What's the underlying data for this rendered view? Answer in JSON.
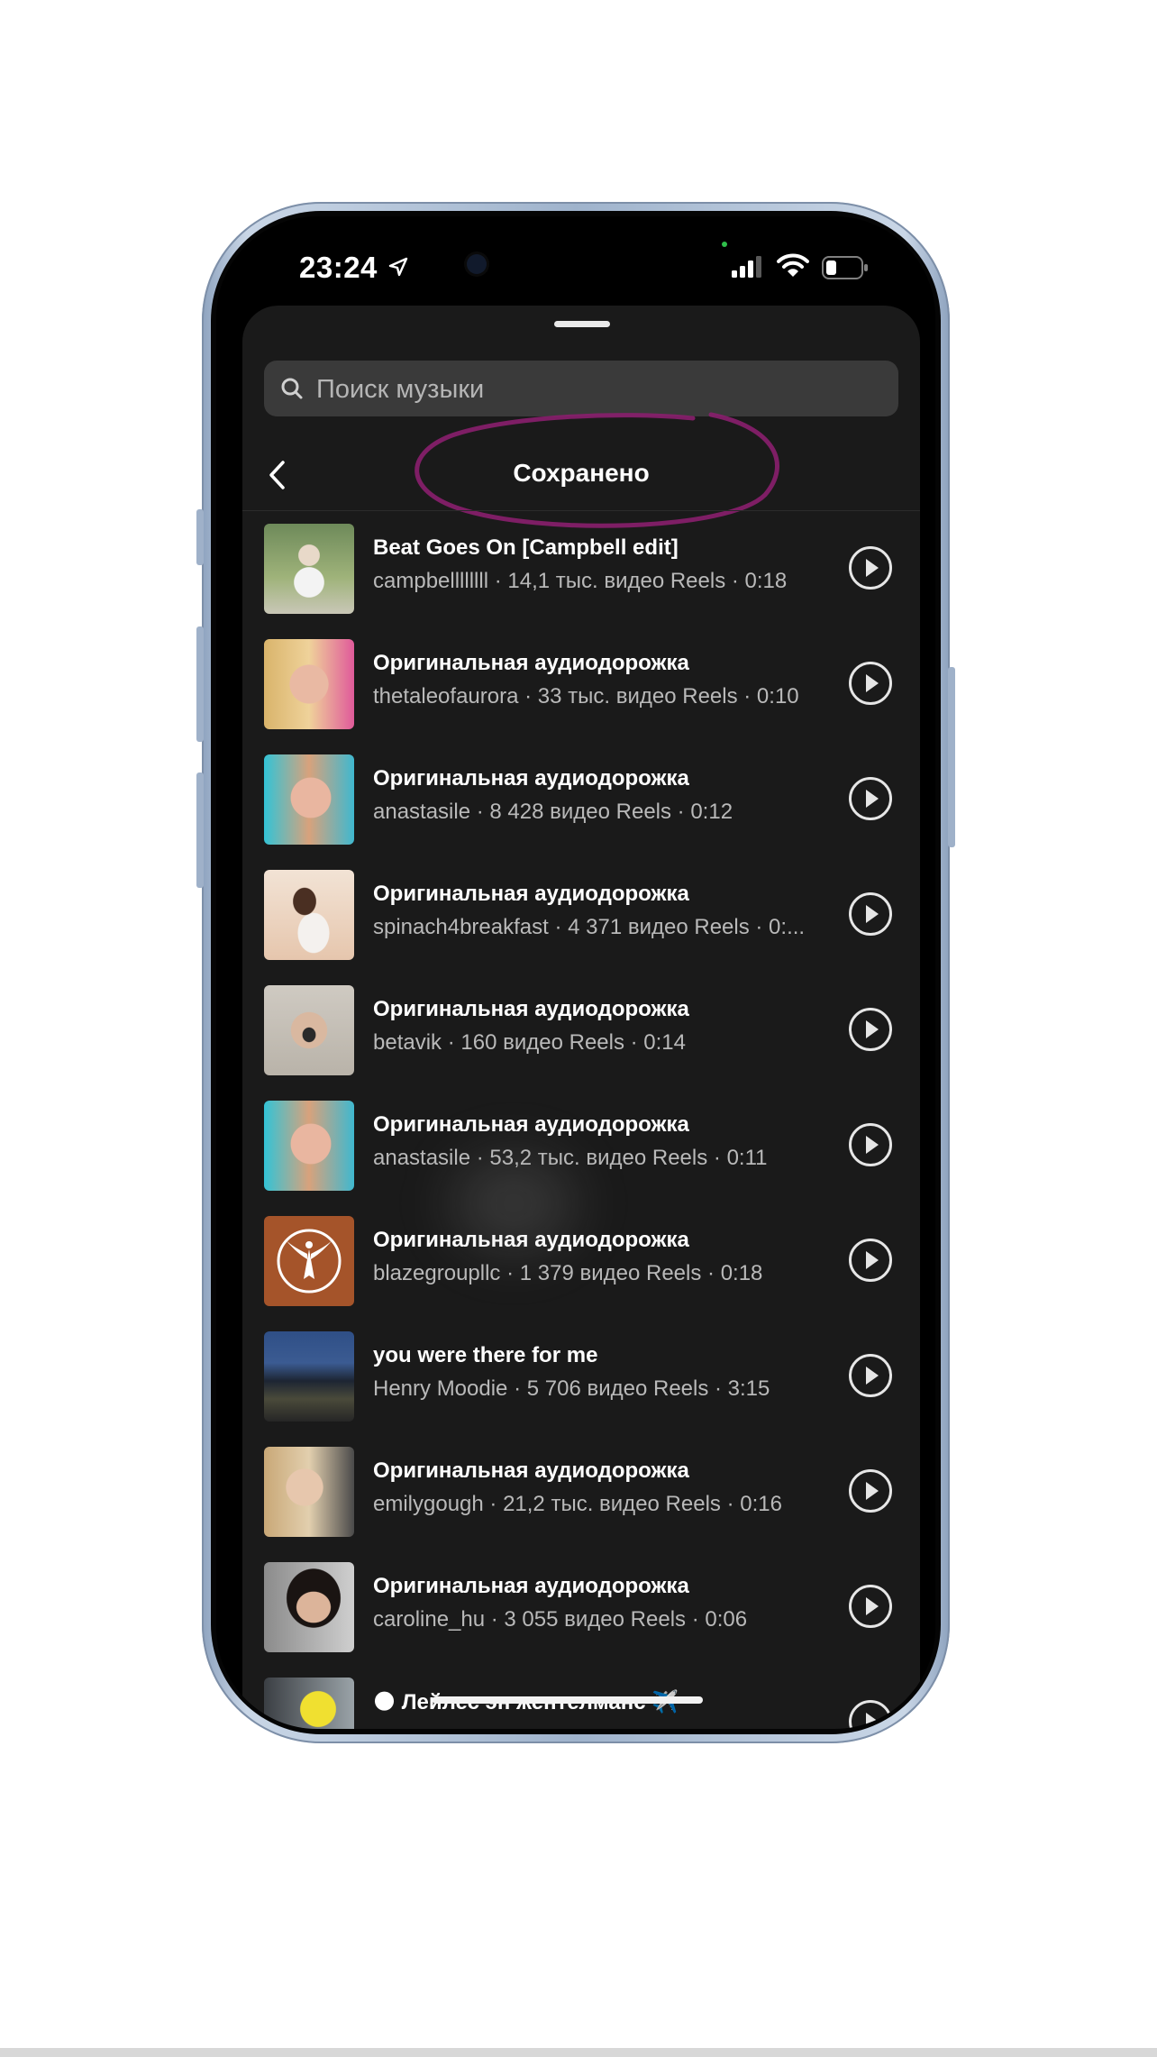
{
  "status_bar": {
    "time": "23:24"
  },
  "search": {
    "placeholder": "Поиск музыки"
  },
  "header": {
    "title": "Сохранено"
  },
  "tracks": [
    {
      "title": "Beat Goes On [Campbell edit]",
      "subtitle": "campbellllllll · 14,1 тыс. видео Reels · 0:18"
    },
    {
      "title": "Оригинальная аудиодорожка",
      "subtitle": "thetaleofaurora · 33 тыс. видео Reels · 0:10"
    },
    {
      "title": "Оригинальная аудиодорожка",
      "subtitle": "anastasile · 8 428 видео Reels · 0:12"
    },
    {
      "title": "Оригинальная аудиодорожка",
      "subtitle": "spinach4breakfast · 4 371 видео Reels · 0:..."
    },
    {
      "title": "Оригинальная аудиодорожка",
      "subtitle": "betavik · 160 видео Reels · 0:14"
    },
    {
      "title": "Оригинальная аудиодорожка",
      "subtitle": "anastasile · 53,2 тыс. видео Reels · 0:11"
    },
    {
      "title": "Оригинальная аудиодорожка",
      "subtitle": "blazegroupllc · 1 379 видео Reels · 0:18"
    },
    {
      "title": "you were there for me",
      "subtitle": "Henry Moodie · 5 706 видео Reels · 3:15"
    },
    {
      "title": "Оригинальная аудиодорожка",
      "subtitle": "emilygough · 21,2 тыс. видео Reels · 0:16"
    },
    {
      "title": "Оригинальная аудиодорожка",
      "subtitle": "caroline_hu · 3 055 видео Reels · 0:06"
    },
    {
      "title": "🌑 Лейлес эн жентелманс ✈️",
      "subtitle": ""
    }
  ],
  "colors": {
    "background": "#1a1a1a",
    "annotation": "#8a1f6e",
    "text_primary": "#ffffff",
    "text_secondary": "#b9b9b9"
  },
  "icons": {
    "search": "search-icon",
    "back": "chevron-left-icon",
    "play": "play-circle-icon",
    "location": "location-arrow-icon",
    "signal": "signal-icon",
    "wifi": "wifi-icon",
    "battery": "battery-icon"
  }
}
